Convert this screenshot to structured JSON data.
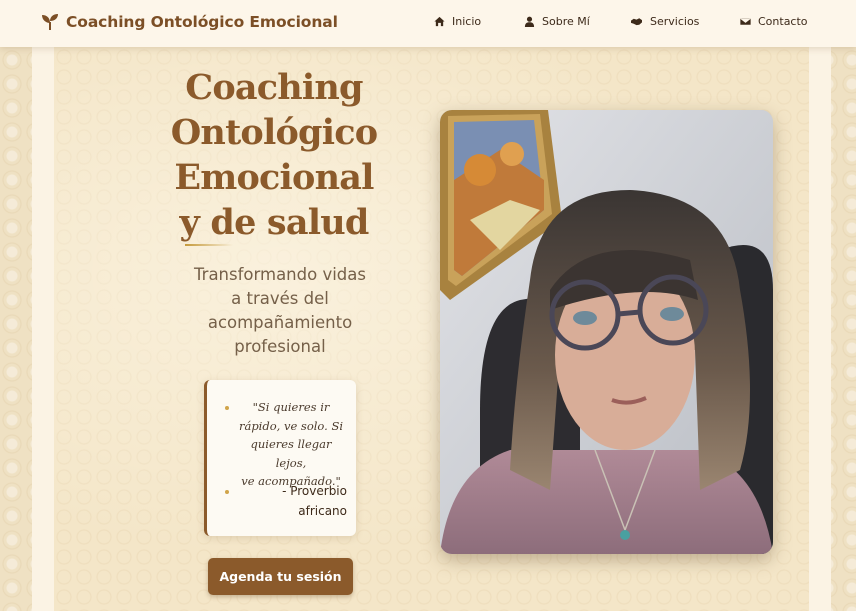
{
  "brand": {
    "name": "Coaching Ontológico Emocional",
    "icon": "sprout-icon"
  },
  "nav": [
    {
      "label": "Inicio",
      "icon": "home-icon"
    },
    {
      "label": "Sobre Mí",
      "icon": "user-icon"
    },
    {
      "label": "Servicios",
      "icon": "handshake-icon"
    },
    {
      "label": "Contacto",
      "icon": "envelope-icon"
    }
  ],
  "hero": {
    "title_lines": [
      "Coaching",
      "Ontológico",
      "Emocional",
      "y de salud"
    ],
    "subtitle_lines": [
      "Transformando vidas",
      "a través del",
      "acompañamiento",
      "profesional"
    ],
    "quote_lines": [
      "\"Si quieres ir",
      "rápido, ve solo. Si",
      "quieres llegar lejos,",
      "ve acompañado.\""
    ],
    "quote_author_lines": [
      "- Proverbio",
      "africano"
    ],
    "cta_label": "Agenda tu sesión"
  },
  "colors": {
    "brand_brown": "#8b5a2b",
    "accent_gold": "#d0a44a",
    "nav_bg": "#fdf6ea"
  }
}
